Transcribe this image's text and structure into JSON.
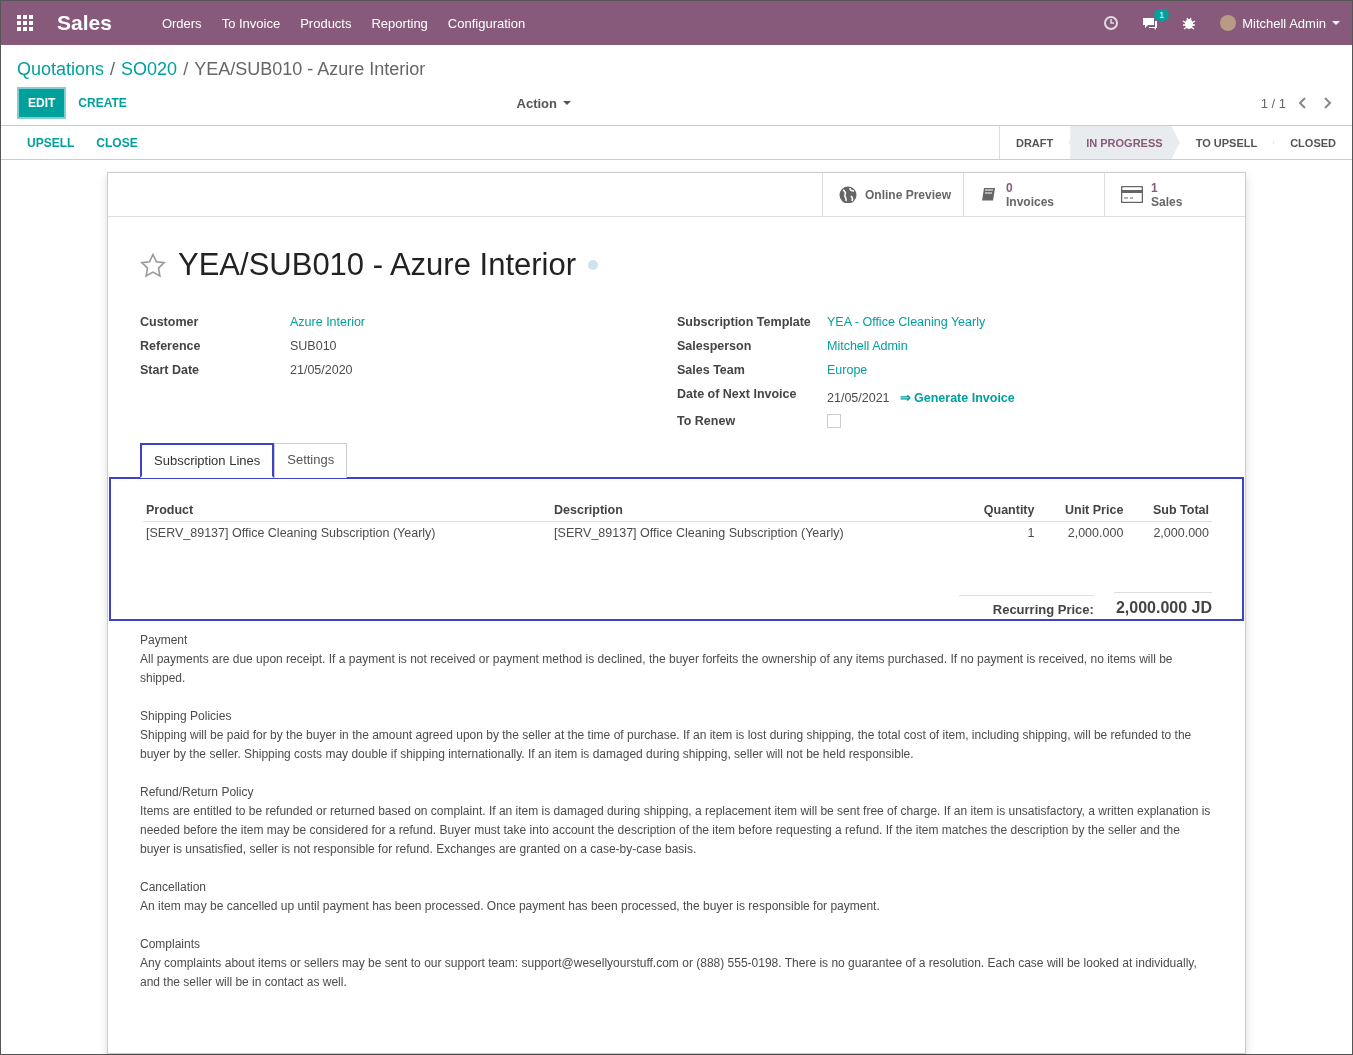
{
  "navbar": {
    "app": "Sales",
    "menu": [
      "Orders",
      "To Invoice",
      "Products",
      "Reporting",
      "Configuration"
    ],
    "messages_count": "1",
    "user": "Mitchell Admin"
  },
  "breadcrumbs": [
    {
      "label": "Quotations",
      "link": true
    },
    {
      "separator": "/",
      "label": "SO020",
      "link": true
    },
    {
      "separator": "/",
      "label": "YEA/SUB010 - Azure Interior",
      "link": false
    }
  ],
  "buttons": {
    "primary": "EDIT",
    "secondary": "CREATE",
    "action": "Action",
    "pager": "1 / 1"
  },
  "header_buttons": [
    "UPSELL",
    "CLOSE"
  ],
  "stages": [
    {
      "label": "DRAFT",
      "selected": false
    },
    {
      "label": "IN PROGRESS",
      "selected": true
    },
    {
      "label": "TO UPSELL",
      "selected": false
    },
    {
      "label": "CLOSED",
      "selected": false
    }
  ],
  "smart_buttons": [
    {
      "kind": "globe",
      "label": "Online Preview"
    },
    {
      "kind": "book",
      "count": "0",
      "label": "Invoices"
    },
    {
      "kind": "card",
      "count": "1",
      "label": "Sales"
    }
  ],
  "title": {
    "text": "YEA/SUB010 - Azure Interior",
    "favorite": false
  },
  "left_fields": [
    {
      "label": "Customer",
      "value": "Azure Interior",
      "link": true
    },
    {
      "label": "Reference",
      "value": "SUB010",
      "link": false
    },
    {
      "label": "Start Date",
      "value": "21/05/2020",
      "link": false
    }
  ],
  "right_fields": [
    {
      "kind": "text",
      "label": "Subscription Template",
      "value": "YEA - Office Cleaning Yearly",
      "link": true
    },
    {
      "kind": "text",
      "label": "Salesperson",
      "value": "Mitchell Admin",
      "link": true
    },
    {
      "kind": "text",
      "label": "Sales Team",
      "value": "Europe",
      "link": true
    },
    {
      "kind": "action",
      "label": "Date of Next Invoice",
      "value": "21/05/2021",
      "action": "⇒ Generate Invoice"
    },
    {
      "kind": "checkbox",
      "label": "To Renew",
      "checked": false
    }
  ],
  "tabs": [
    {
      "label": "Subscription Lines",
      "selected": true
    },
    {
      "label": "Settings",
      "selected": false
    }
  ],
  "table": {
    "columns": [
      "Product",
      "Description",
      "Quantity",
      "Unit Price",
      "Sub Total"
    ],
    "rows": [
      [
        "[SERV_89137] Office Cleaning Subscription (Yearly)",
        "[SERV_89137] Office Cleaning Subscription (Yearly)",
        "1",
        "2,000.000",
        "2,000.000"
      ]
    ]
  },
  "total": {
    "label": "Recurring Price:",
    "value": "2,000.000 JD"
  },
  "terms": [
    {
      "heading": "Payment",
      "text": "All payments are due upon receipt. If a payment is not received or payment method is declined, the buyer forfeits the ownership of any items purchased. If no payment is received, no items will be shipped."
    },
    {
      "heading": "Shipping Policies",
      "text": "Shipping will be paid for by the buyer in the amount agreed upon by the seller at the time of purchase. If an item is lost during shipping, the total cost of item, including shipping, will be refunded to the buyer by the seller. Shipping costs may double if shipping internationally. If an item is damaged during shipping, seller will not be held responsible."
    },
    {
      "heading": "Refund/Return Policy",
      "text": "Items are entitled to be refunded or returned based on complaint. If an item is damaged during shipping, a replacement item will be sent free of charge. If an item is unsatisfactory, a written explanation is needed before the item may be considered for a refund. Buyer must take into account the description of the item before requesting a refund. If the item matches the description by the seller and the buyer is unsatisfied, seller is not responsible for refund. Exchanges are granted on a case-by-case basis."
    },
    {
      "heading": "Cancellation",
      "text": "An item may be cancelled up until payment has been processed. Once payment has been processed, the buyer is responsible for payment."
    },
    {
      "heading": "Complaints",
      "text": "Any complaints about items or sellers may be sent to our support team: support@wesellyourstuff.com or (888) 555-0198. There is no guarantee of a resolution. Each case will be looked at individually, and the seller will be in contact as well."
    }
  ]
}
